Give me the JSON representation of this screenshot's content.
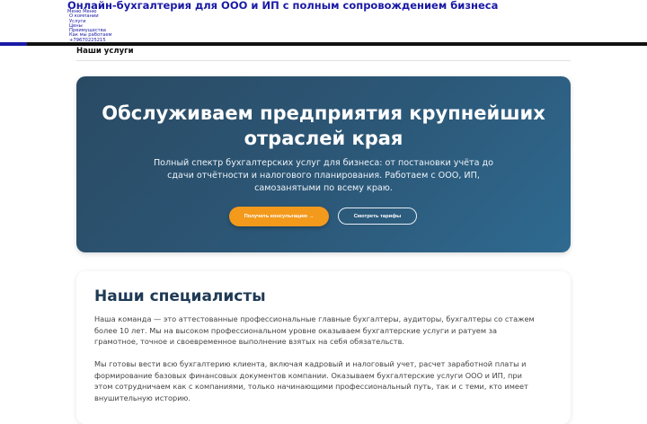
{
  "header": {
    "site_title": "Онлайн-бухгалтерия для ООО и ИП с полным сопровождением бизнеса",
    "nav": {
      "menu_toggle": "Меню Меню",
      "items": [
        "О компании",
        "Услуги",
        "Цены",
        "Преимущества",
        "Как мы работаем",
        "+79670225215"
      ]
    }
  },
  "breadcrumb": {
    "current": "Наши услуги"
  },
  "hero": {
    "title": "Обслуживаем предприятия крупнейших отраслей края",
    "description": "Полный спектр бухгалтерских услуг для бизнеса: от постановки учёта до сдачи отчётности и налогового планирования. Работаем с ООО, ИП, самозанятыми по всему краю.",
    "primary_button": "Получить консультацию →",
    "secondary_button": "Смотреть тарифы"
  },
  "specialists": {
    "title": "Наши специалисты",
    "paragraph1": "Наша команда — это аттестованные профессиональные главные бухгалтеры, аудиторы, бухгалтеры со стажем более 10 лет. Мы на высоком профессиональном уровне оказываем бухгалтерские услуги и ратуем за грамотное, точное и своевременное выполнение взятых на себя обязательств.",
    "paragraph2": "Мы готовы вести всю бухгалтерию клиента, включая кадровый и налоговый учет, расчет заработной платы и формирование базовых финансовых документов компании. Оказываем бухгалтерские услуги ООО и ИП, при этом сотрудничаем как с компаниями, только начинающими профессиональный путь, так и с теми, кто имеет внушительную историю."
  },
  "colors": {
    "link": "#1a1aa6",
    "hero_bg": "#2c5878",
    "accent": "#f39a1d",
    "heading": "#1f3a55"
  }
}
